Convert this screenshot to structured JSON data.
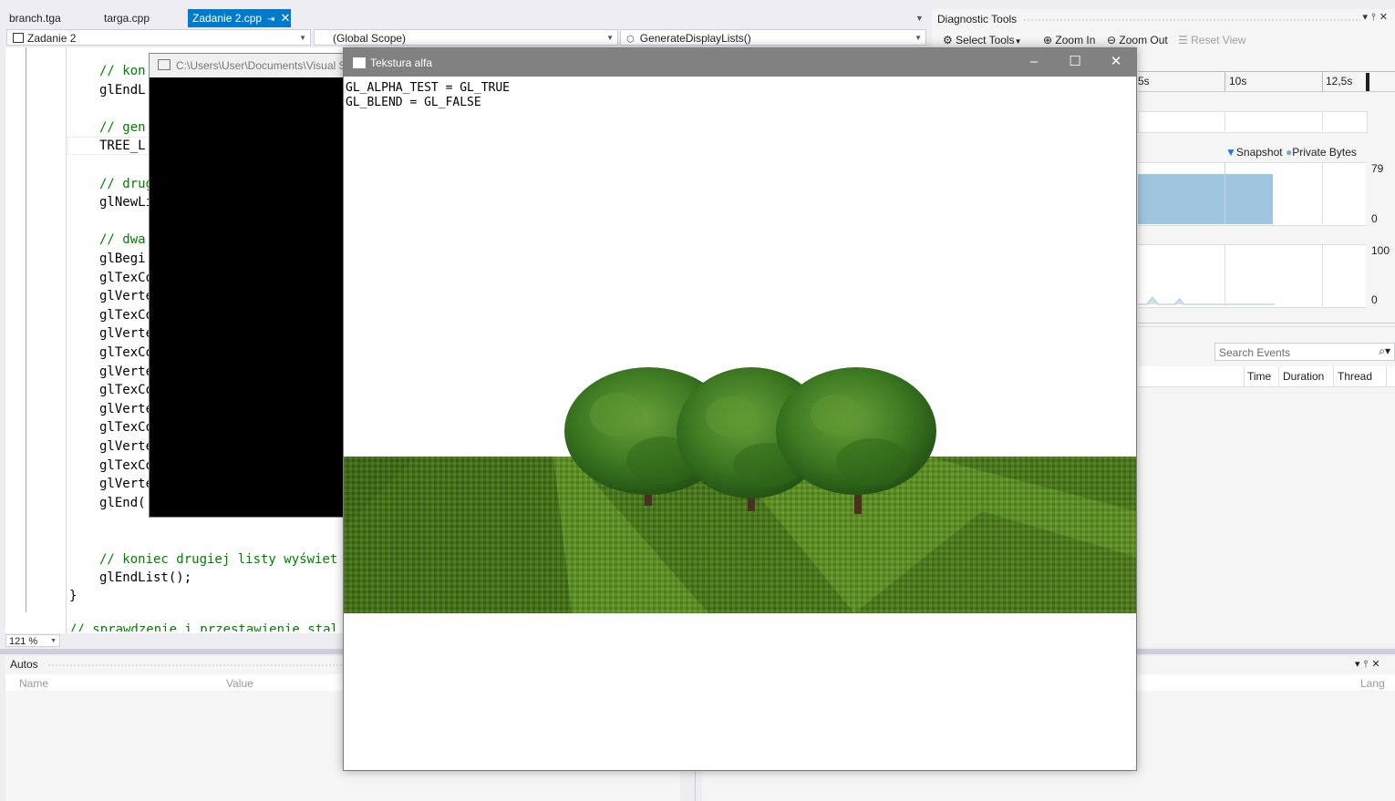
{
  "tabs": [
    {
      "label": "branch.tga",
      "active": false
    },
    {
      "label": "targa.cpp",
      "active": false
    },
    {
      "label": "Zadanie 2.cpp",
      "active": true
    }
  ],
  "navbar": {
    "project": "Zadanie 2",
    "scope": "(Global Scope)",
    "function": "GenerateDisplayLists()"
  },
  "code_lines": [
    {
      "text": "// kon",
      "comment": true
    },
    {
      "text": "glEndL",
      "comment": false
    },
    {
      "text": "",
      "comment": false
    },
    {
      "text": "// gen",
      "comment": true
    },
    {
      "text": "TREE_L",
      "comment": false
    },
    {
      "text": "",
      "comment": false
    },
    {
      "text": "// drug",
      "comment": true
    },
    {
      "text": "glNewLi",
      "comment": false
    },
    {
      "text": "",
      "comment": false
    },
    {
      "text": "// dwa",
      "comment": true
    },
    {
      "text": "glBegi",
      "comment": false
    },
    {
      "text": "glTexCo",
      "comment": false
    },
    {
      "text": "glVerte",
      "comment": false
    },
    {
      "text": "glTexCo",
      "comment": false
    },
    {
      "text": "glVerte",
      "comment": false
    },
    {
      "text": "glTexCo",
      "comment": false
    },
    {
      "text": "glVerte",
      "comment": false
    },
    {
      "text": "glTexCo",
      "comment": false
    },
    {
      "text": "glVerte",
      "comment": false
    },
    {
      "text": "glTexCo",
      "comment": false
    },
    {
      "text": "glVerte",
      "comment": false
    },
    {
      "text": "glTexCo",
      "comment": false
    },
    {
      "text": "glVerte",
      "comment": false
    },
    {
      "text": "glEnd(",
      "comment": false
    },
    {
      "text": "",
      "comment": false
    },
    {
      "text": "",
      "comment": false
    },
    {
      "text": "// koniec drugiej listy wyświet",
      "comment": true
    },
    {
      "text": "glEndList();",
      "comment": false
    }
  ],
  "closing_brace": "}",
  "partial_comment": "// sprawdzenie i przestawienie stal",
  "zoom": "121 %",
  "console": {
    "title": "C:\\Users\\User\\Documents\\Visual S"
  },
  "app_window": {
    "title": "Tekstura alfa",
    "status_lines": [
      "GL_ALPHA_TEST = GL_TRUE",
      "GL_BLEND = GL_FALSE"
    ]
  },
  "diagnostics": {
    "title": "Diagnostic Tools",
    "toolbar": {
      "select_tools": "Select Tools",
      "zoom_in": "Zoom In",
      "zoom_out": "Zoom Out",
      "reset_view": "Reset View"
    },
    "time_ticks": [
      "5s",
      "10s",
      "12,5s"
    ],
    "legend": {
      "snapshot": "Snapshot",
      "private_bytes": "Private Bytes"
    },
    "memory_axis": {
      "max": "79",
      "min": "0"
    },
    "cpu_axis": {
      "max": "100",
      "min": "0"
    },
    "search_placeholder": "Search Events",
    "event_columns": [
      "Time",
      "Duration",
      "Thread"
    ]
  },
  "autos": {
    "title": "Autos",
    "columns": [
      "Name",
      "Value"
    ]
  },
  "bottom_right_partial_header": "Lang",
  "colors": {
    "accent": "#007acc",
    "app_title_bg": "#818181",
    "memory_fill": "#9fc6de",
    "comment": "#008000"
  }
}
